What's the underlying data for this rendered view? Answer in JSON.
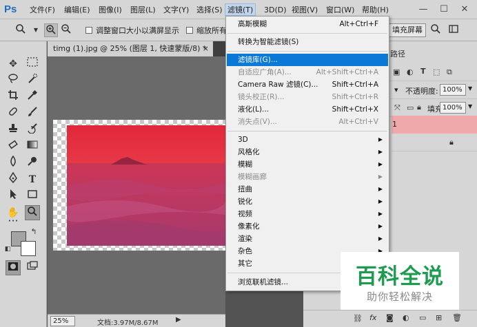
{
  "app": {
    "logo": "Ps"
  },
  "menubar": {
    "items": [
      "文件(F)",
      "编辑(E)",
      "图像(I)",
      "图层(L)",
      "文字(Y)",
      "选择(S)",
      "滤镜(T)",
      "3D(D)",
      "视图(V)",
      "窗口(W)",
      "帮助(H)"
    ],
    "active_index": 6,
    "window_controls": [
      "—",
      "☐",
      "✕"
    ]
  },
  "options": {
    "resize_window_label": "调整窗口大小以满屏显示",
    "zoom_all_label": "缩放所有",
    "fill_screen_button": "填充屏幕"
  },
  "document": {
    "tab_title": "timg (1).jpg @ 25% (图层 1, 快速蒙版/8) *",
    "tab_close": "×",
    "zoom": "25%",
    "doc_size": "文档:3.97M/8.67M"
  },
  "filter_menu": {
    "items": [
      {
        "label": "高斯模糊",
        "shortcut": "Alt+Ctrl+F",
        "state": "enabled"
      },
      {
        "label": "转换为智能滤镜(S)",
        "shortcut": "",
        "state": "enabled"
      },
      {
        "label": "滤镜库(G)...",
        "shortcut": "",
        "state": "highlight"
      },
      {
        "label": "自适应广角(A)...",
        "shortcut": "Alt+Shift+Ctrl+A",
        "state": "disabled"
      },
      {
        "label": "Camera Raw 滤镜(C)...",
        "shortcut": "Shift+Ctrl+A",
        "state": "enabled"
      },
      {
        "label": "镜头校正(R)...",
        "shortcut": "Shift+Ctrl+R",
        "state": "disabled"
      },
      {
        "label": "液化(L)...",
        "shortcut": "Shift+Ctrl+X",
        "state": "enabled"
      },
      {
        "label": "消失点(V)...",
        "shortcut": "Alt+Ctrl+V",
        "state": "disabled"
      },
      {
        "label": "3D",
        "submenu": true,
        "state": "enabled"
      },
      {
        "label": "风格化",
        "submenu": true,
        "state": "enabled"
      },
      {
        "label": "模糊",
        "submenu": true,
        "state": "enabled"
      },
      {
        "label": "模糊画廊",
        "submenu": true,
        "state": "disabled"
      },
      {
        "label": "扭曲",
        "submenu": true,
        "state": "enabled"
      },
      {
        "label": "锐化",
        "submenu": true,
        "state": "enabled"
      },
      {
        "label": "视频",
        "submenu": true,
        "state": "enabled"
      },
      {
        "label": "像素化",
        "submenu": true,
        "state": "enabled"
      },
      {
        "label": "渲染",
        "submenu": true,
        "state": "enabled"
      },
      {
        "label": "杂色",
        "submenu": true,
        "state": "enabled"
      },
      {
        "label": "其它",
        "submenu": true,
        "state": "enabled"
      },
      {
        "label": "浏览联机滤镜...",
        "shortcut": "",
        "state": "enabled"
      }
    ],
    "highlight_color": "#0a78d7"
  },
  "layers_panel": {
    "tab_partial": "路径",
    "opacity_label": "不透明度:",
    "opacity_value": "100%",
    "fill_label": "填充:",
    "fill_value": "100%",
    "layer_name": "1"
  },
  "watermark": {
    "main": "百科全说",
    "sub": "助你轻松解决"
  }
}
